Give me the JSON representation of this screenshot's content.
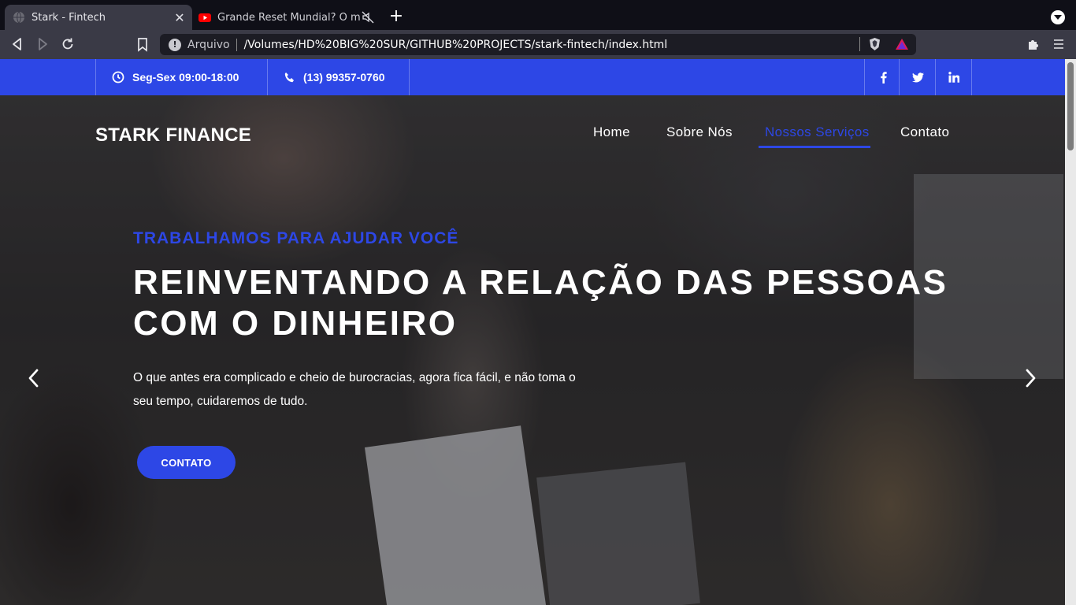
{
  "browser": {
    "tabs": [
      {
        "title": "Stark - Fintech",
        "active": true
      },
      {
        "title": "Grande Reset Mundial? O mercado",
        "active": false
      }
    ],
    "new_tab": "+",
    "address": {
      "origin_label": "Arquivo",
      "url": "/Volumes/HD%20BIG%20SUR/GITHUB%20PROJECTS/stark-fintech/index.html"
    }
  },
  "topbar": {
    "hours": "Seg-Sex 09:00-18:00",
    "phone": "(13) 99357-0760",
    "social": [
      "f",
      "twitter",
      "in"
    ]
  },
  "header": {
    "brand": "STARK FINANCE",
    "nav": [
      "Home",
      "Sobre Nós",
      "Nossos Serviços",
      "Contato"
    ],
    "active_nav": "Nossos Serviços"
  },
  "hero": {
    "eyebrow": "TRABALHAMOS PARA AJUDAR VOCÊ",
    "headline_line1": "REINVENTANDO A RELAÇÃO DAS PESSOAS",
    "headline_line2": "COM O DINHEIRO",
    "lead": "O que antes era complicado e cheio de burocracias, agora fica fácil, e não toma o seu tempo, cuidaremos de tudo.",
    "cta": "CONTATO"
  },
  "colors": {
    "brand_blue": "#2d47e6",
    "chrome_dark": "#0f0f17",
    "chrome_toolbar": "#3a3a46"
  }
}
